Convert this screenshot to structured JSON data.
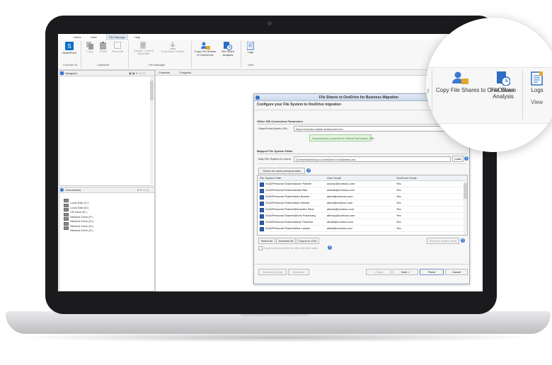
{
  "ribbon": {
    "tabs": [
      "Home",
      "View",
      "File Manager",
      "Help"
    ],
    "groups": [
      {
        "label": "Connect To",
        "buttons": [
          "SharePoint"
        ]
      },
      {
        "label": "Clipboard",
        "buttons": [
          "Copy",
          "Paste",
          "Select All"
        ]
      },
      {
        "label": "File Manager",
        "buttons": [
          "Update Content Metadata",
          "Download Content"
        ]
      },
      {
        "label": "",
        "buttons": [
          "Copy File Shares to OneDrives",
          "File Share Analysis"
        ]
      },
      {
        "label": "View",
        "buttons": [
          "Logs"
        ]
      }
    ]
  },
  "navigator": {
    "title": "Navigator"
  },
  "connections": {
    "title": "Connections",
    "items": [
      "Local Disk (C:)",
      "Local Disk (D:)",
      "CR Drive (E:)",
      "Network Drive (F:)",
      "Network Drive (G:)",
      "Network Drive (H:)",
      "Network Drive (Z:)"
    ]
  },
  "content_tabs": [
    "Contents",
    "Progress"
  ],
  "dialog": {
    "title": "File Shares to OneDrive for Business Migration",
    "subtitle": "Configure your File System to OneDrive migration",
    "section1": "Office 365 Connection Parameters",
    "admin_url_label": "SharePoint Admin URL:",
    "admin_url_value": "https://contoso-admin.sharepoint.com",
    "success_message": "Successfully connected to SharePoint Admin URL",
    "section2": "Mapped File System Paths",
    "map_label": "Map File System to Users:",
    "map_value": "D:\\HomeDirectory to OneDrive for Business.csv",
    "load_button": "Load",
    "check_button": "Check for users personal sites",
    "columns": [
      "File System Path",
      "User Email",
      "OneDrive Exists"
    ],
    "rows": [
      [
        "\\\\UAI\\Personal Shares\\Aaron Painter",
        "aaronp@contoso.com",
        "Yes"
      ],
      [
        "\\\\UAI\\Personal Shares\\Adam Barr",
        "adamb@contoso.com",
        "Yes"
      ],
      [
        "\\\\UAI\\Personal Shares\\Alan Brewer",
        "alanb@contoso.com",
        "Yes"
      ],
      [
        "\\\\UAI\\Personal Shares\\Alan Steiner",
        "alans@contoso.com",
        "Yes"
      ],
      [
        "\\\\UAI\\Personal Shares\\Alexandre Silva",
        "alexss@contoso.com",
        "Yes"
      ],
      [
        "\\\\UAI\\Personal Shares\\Alfons Parovszky",
        "alfonsp@contoso.com",
        "Yes"
      ],
      [
        "\\\\UAI\\Personal Shares\\Alicia Thomber",
        "aliciat@contoso.com",
        "Yes"
      ],
      [
        "\\\\UAI\\Personal Shares\\Alisa Lawyer",
        "alisal@contoso.com",
        "Yes"
      ]
    ],
    "select_all": "Select All",
    "deselect_all": "Deselect All",
    "export_csv": "Export to CSV",
    "remove_invalid": "Remove invalid users",
    "create_sites": "Create personal sites for the selected users",
    "generate_script": "Generate Script",
    "schedule": "Schedule",
    "back": "< Back",
    "next": "Next >",
    "finish": "Finish",
    "cancel": "Cancel"
  },
  "zoom": {
    "buttons": [
      "Copy File Shares to OneDrives",
      "File Share Analysis",
      "Logs"
    ],
    "group_label": "View"
  }
}
